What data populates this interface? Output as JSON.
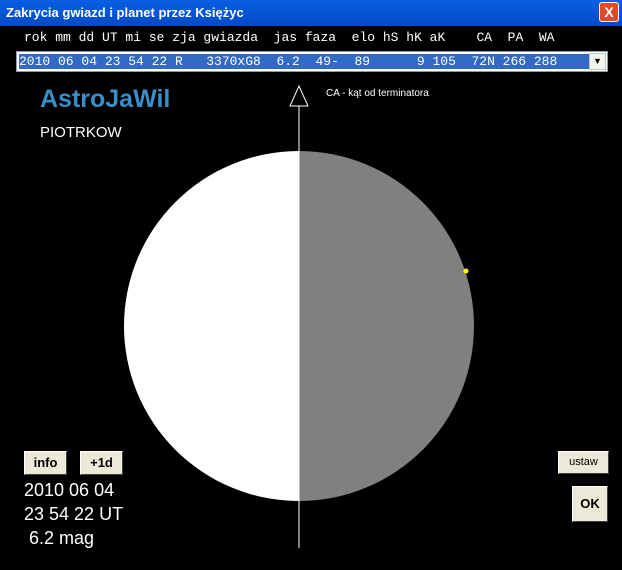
{
  "window": {
    "title": "Zakrycia gwiazd i planet przez Księżyc",
    "close_label": "X"
  },
  "table": {
    "column_header": "rok mm dd UT mi se zja gwiazda  jas faza  elo hS hK aK    CA  PA  WA",
    "selected_row": "2010 06 04 23 54 22 R   3370xG8  6.2  49-  89      9 105  72N 266 288"
  },
  "app": {
    "name": "AstroJaWil",
    "location": "PIOTRKOW",
    "axis_label": "CA - kąt od terminatora"
  },
  "buttons": {
    "info": "info",
    "plus1d": "+1d",
    "ustaw": "ustaw",
    "ok": "OK"
  },
  "event": {
    "date": "2010 06 04",
    "time": "23 54 22 UT",
    "magnitude": " 6.2 mag"
  },
  "colors": {
    "lit": "#ffffff",
    "dark": "#808080",
    "star": "#ffff00",
    "accent": "#3a8ec8"
  }
}
